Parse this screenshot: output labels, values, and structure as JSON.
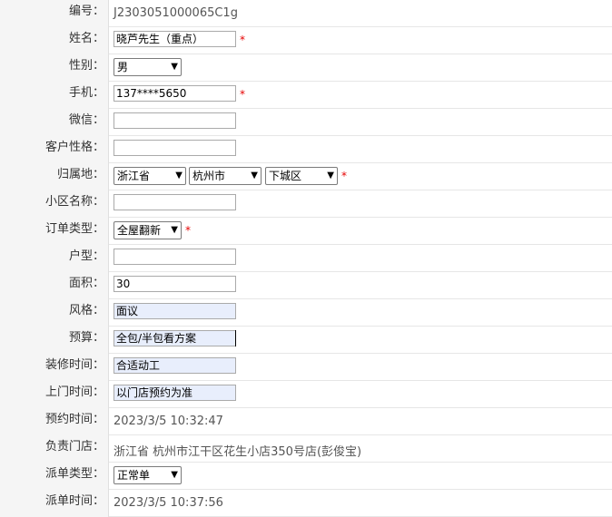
{
  "fields": [
    {
      "label": "编号：",
      "value": "J2303051000065C1g"
    },
    {
      "label": "姓名：",
      "value": "晓芦先生（重点）",
      "required": "*"
    },
    {
      "label": "性别：",
      "value": "男"
    },
    {
      "label": "手机：",
      "value": "137****5650",
      "required": "*"
    },
    {
      "label": "微信：",
      "value": ""
    },
    {
      "label": "客户性格：",
      "value": ""
    },
    {
      "label": "归属地：",
      "province": "浙江省",
      "city": "杭州市",
      "district": "下城区",
      "required": "*"
    },
    {
      "label": "小区名称：",
      "value": ""
    },
    {
      "label": "订单类型：",
      "value": "全屋翻新",
      "required": "*"
    },
    {
      "label": "户型：",
      "value": ""
    },
    {
      "label": "面积：",
      "value": "30"
    },
    {
      "label": "风格：",
      "value": "面议"
    },
    {
      "label": "预算：",
      "value": "全包/半包看方案"
    },
    {
      "label": "装修时间：",
      "value": "合适动工"
    },
    {
      "label": "上门时间：",
      "value": "以门店预约为准"
    },
    {
      "label": "预约时间：",
      "value": "2023/3/5 10:32:47"
    },
    {
      "label": "负责门店：",
      "value": "浙江省 杭州市江干区花生小店350号店(彭俊宝)"
    },
    {
      "label": "派单类型：",
      "value": "正常单"
    },
    {
      "label": "派单时间：",
      "value": "2023/3/5 10:37:56"
    }
  ],
  "icons": {
    "dropdown": "chevron-down-icon"
  }
}
